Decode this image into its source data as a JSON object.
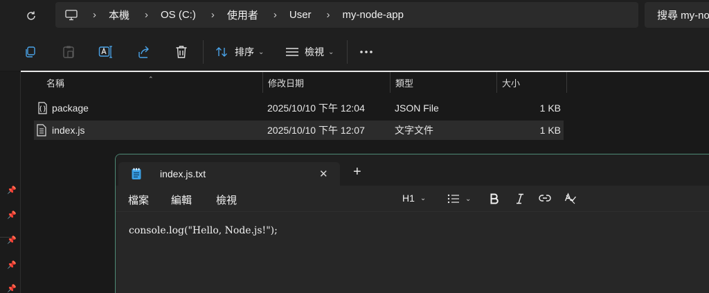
{
  "breadcrumb": {
    "items": [
      "本機",
      "OS (C:)",
      "使用者",
      "User",
      "my-node-app"
    ]
  },
  "search": {
    "placeholder": "搜尋 my-node-app"
  },
  "toolbar": {
    "sort_label": "排序",
    "view_label": "檢視",
    "icons": [
      "copy-icon",
      "paste-icon",
      "rename-icon",
      "share-icon",
      "delete-icon",
      "more-icon"
    ]
  },
  "columns": {
    "name": "名稱",
    "modified": "修改日期",
    "type": "類型",
    "size": "大小"
  },
  "files": [
    {
      "name": "package",
      "modified": "2025/10/10 下午 12:04",
      "type": "JSON File",
      "size": "1 KB",
      "icon": "json-file-icon"
    },
    {
      "name": "index.js",
      "modified": "2025/10/10 下午 12:07",
      "type": "文字文件",
      "size": "1 KB",
      "icon": "text-file-icon"
    }
  ],
  "notepad": {
    "tab_title": "index.js.txt",
    "menus": {
      "file": "檔案",
      "edit": "編輯",
      "view": "檢視"
    },
    "heading_select": "H1",
    "content": "console.log(\"Hello, Node.js!\");"
  },
  "colors": {
    "accent_border": "#4e8a76",
    "background": "#191919",
    "surface": "#272727"
  }
}
